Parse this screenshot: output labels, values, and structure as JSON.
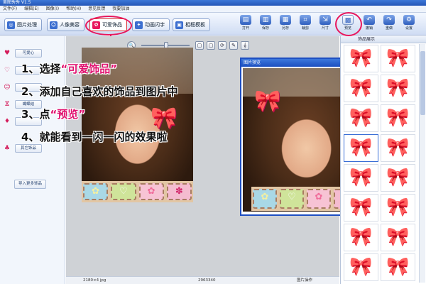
{
  "window": {
    "title": "美图秀秀 V1.5"
  },
  "menu": [
    "文件(F)",
    "编辑(E)",
    "图像(I)",
    "帮助(H)",
    "意见反馈",
    "我要加油"
  ],
  "tabs": [
    {
      "label": "图片处理",
      "icon": "◎"
    },
    {
      "label": "人像美容",
      "icon": "☺"
    },
    {
      "label": "可爱饰品",
      "icon": "✿"
    },
    {
      "label": "动画闪字",
      "icon": "✦"
    },
    {
      "label": "相框模板",
      "icon": "▣"
    }
  ],
  "toolbar_buttons": [
    {
      "label": "打开",
      "icon": "▤"
    },
    {
      "label": "保存",
      "icon": "▥"
    },
    {
      "label": "另存",
      "icon": "▦"
    },
    {
      "label": "裁剪",
      "icon": "⌗"
    },
    {
      "label": "尺寸",
      "icon": "⇲"
    },
    {
      "label": "预览",
      "icon": "▩"
    },
    {
      "label": "撤销",
      "icon": "↶"
    },
    {
      "label": "重做",
      "icon": "↷"
    },
    {
      "label": "设置",
      "icon": "⚙"
    }
  ],
  "left_panel": {
    "categories": [
      {
        "label": "可爱心",
        "icon": "♥"
      },
      {
        "label": "",
        "icon": "♡"
      },
      {
        "label": "",
        "icon": "☺"
      },
      {
        "label": "蝴蝶结",
        "icon": "ⴵ"
      },
      {
        "label": "",
        "icon": "♦"
      },
      {
        "label": "其它饰品",
        "icon": "♣"
      }
    ],
    "import_button": "导入更多饰品"
  },
  "zoom_controls": [
    "🔍",
    "▢",
    "▢",
    "⟳",
    "✎",
    "𝄞"
  ],
  "instructions": [
    {
      "num": "1、",
      "text": "选择",
      "quoted": "“可爱饰品”"
    },
    {
      "num": "2、",
      "text": "添加自己喜欢的饰品到图片中",
      "quoted": ""
    },
    {
      "num": "3、",
      "text": "点",
      "quoted": "“预览”"
    },
    {
      "num": "4、",
      "text": "就能看到一闪一闪的效果啦",
      "quoted": ""
    }
  ],
  "stamps": [
    "✿",
    "♡",
    "✿",
    "✽"
  ],
  "bow_icon": "🎀",
  "preview_window": {
    "title": "图片预览",
    "close": "✕"
  },
  "right_panel": {
    "title": "饰品展示",
    "items": [
      "🎀",
      "🎀",
      "🎀",
      "🎀",
      "🎀",
      "🎀",
      "🎀",
      "🎀",
      "🎀",
      "🎀",
      "🎀",
      "🎀",
      "🎀",
      "🎀",
      "🎀",
      "🎀"
    ]
  },
  "status": {
    "size": "2180×4 jpg",
    "zoom": "2963340",
    "right": "图片操作"
  },
  "colors": {
    "accent": "#e8175d",
    "titlebar": "#2456b7"
  }
}
